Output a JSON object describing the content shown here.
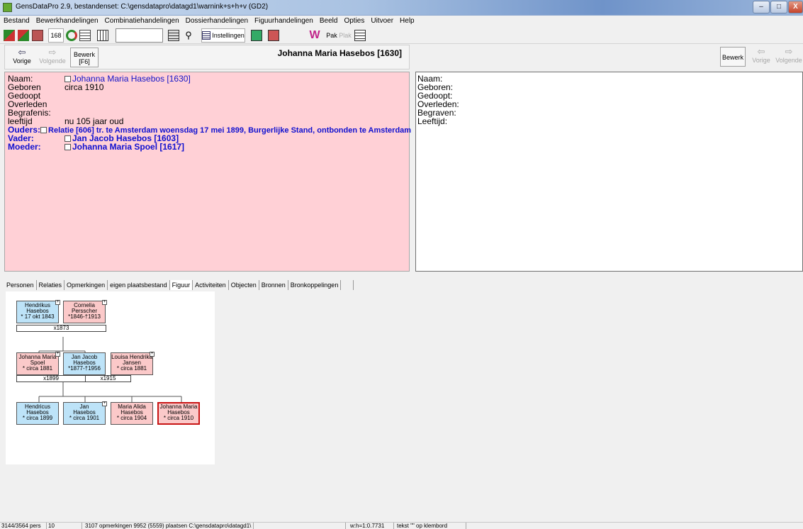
{
  "window": {
    "title": "GensDataPro 2.9, bestandenset: C:\\gensdatapro\\datagd1\\warnink+s+h+v (GD2)",
    "minimize": "–",
    "maximize": "□",
    "close": "X"
  },
  "menu": [
    "Bestand",
    "Bewerkhandelingen",
    "Combinatiehandelingen",
    "Dossierhandelingen",
    "Figuurhandelingen",
    "Beeld",
    "Opties",
    "Uitvoer",
    "Help"
  ],
  "toolbar": {
    "num_label": "168",
    "instellingen": "Instellingen",
    "w_label": "W",
    "pak": "Pak",
    "plak": "Plak"
  },
  "left": {
    "prev": "Vorige",
    "next": "Volgende",
    "edit": "Bewerk",
    "edit_key": "[F6]",
    "person_title": "Johanna Maria Hasebos [1630]",
    "rows": [
      {
        "label": "Naam:",
        "value": "Johanna Maria Hasebos [1630]"
      },
      {
        "label": "Geboren",
        "value": "circa 1910"
      },
      {
        "label": "Gedoopt",
        "value": ""
      },
      {
        "label": "Overleden",
        "value": ""
      },
      {
        "label": "Begrafenis:",
        "value": ""
      },
      {
        "label": "leeftijd",
        "value": "nu 105 jaar oud"
      },
      {
        "label": "Ouders:",
        "value": "Relatie [606] tr. te Amsterdam woensdag 17 mei 1899, Burgerlijke Stand, ontbonden te Amsterdam"
      },
      {
        "label": "Vader:",
        "value": "Jan Jacob Hasebos [1603]"
      },
      {
        "label": "Moeder:",
        "value": "Johanna Maria Spoel [1617]"
      }
    ]
  },
  "right": {
    "edit": "Bewerk",
    "prev": "Vorige",
    "next": "Volgende",
    "rows": [
      "Naam:",
      "Geboren:",
      "Gedoopt:",
      "Overleden:",
      "Begraven:",
      "Leeftijd:"
    ]
  },
  "tabs": [
    "Personen",
    "Relaties",
    "Opmerkingen",
    "eigen plaatsbestand",
    "Figuur",
    "Activiteiten",
    "Objecten",
    "Bronnen",
    "Bronkoppelingen"
  ],
  "active_tab": "Figuur",
  "family": {
    "grandfather": {
      "first": "Hendrikus",
      "last": "Hasebos",
      "dates": "* 17 okt 1843"
    },
    "grandmother": {
      "first": "Cornelia",
      "last": "Persscher",
      "dates": "*1846-†1913"
    },
    "marriage1": "x1873",
    "mother": {
      "first": "Johanna Maria",
      "last": "Spoel",
      "dates": "* circa 1881"
    },
    "father": {
      "first": "Jan Jacob",
      "last": "Hasebos",
      "dates": "*1877-†1956"
    },
    "second_wife": {
      "first": "Louisa Hendrika",
      "last": "Jansen",
      "dates": "* circa 1881"
    },
    "marriage2": "x1899",
    "marriage3": "x1915",
    "children": [
      {
        "first": "Hendricus",
        "last": "Hasebos",
        "dates": "* circa 1899"
      },
      {
        "first": "Jan",
        "last": "Hasebos",
        "dates": "* circa 1901"
      },
      {
        "first": "Maria Alida",
        "last": "Hasebos",
        "dates": "* circa 1904"
      },
      {
        "first": "Johanna Maria",
        "last": "Hasebos",
        "dates": "* circa 1910"
      }
    ]
  },
  "status": {
    "pers": "3144/3564 pers",
    "num": "10",
    "info": "3107 opmerkingen 9952 (5559) plaatsen C:\\gensdatapro\\datagd1\\",
    "ratio": "w:h=1:0.7731",
    "clip": "tekst \"\" op klembord"
  }
}
